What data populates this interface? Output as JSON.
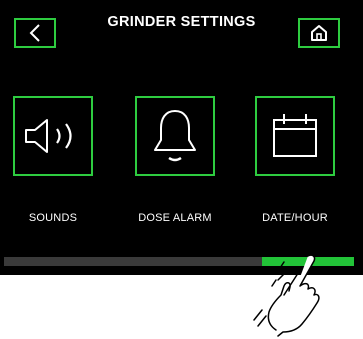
{
  "header": {
    "title": "GRINDER SETTINGS",
    "back_icon": "chevron-left-icon",
    "home_icon": "home-icon"
  },
  "tiles": [
    {
      "label": "SOUNDS",
      "icon": "speaker-icon"
    },
    {
      "label": "DOSE ALARM",
      "icon": "bell-icon"
    },
    {
      "label": "DATE/HOUR",
      "icon": "calendar-icon"
    }
  ],
  "scroll": {
    "position": 1.0
  },
  "colors": {
    "background": "#000000",
    "accent": "#2ecc40",
    "text": "#ffffff",
    "track": "#3a3a3a",
    "thumb": "#22c338"
  },
  "gesture_icon": "swipe-hand-icon"
}
